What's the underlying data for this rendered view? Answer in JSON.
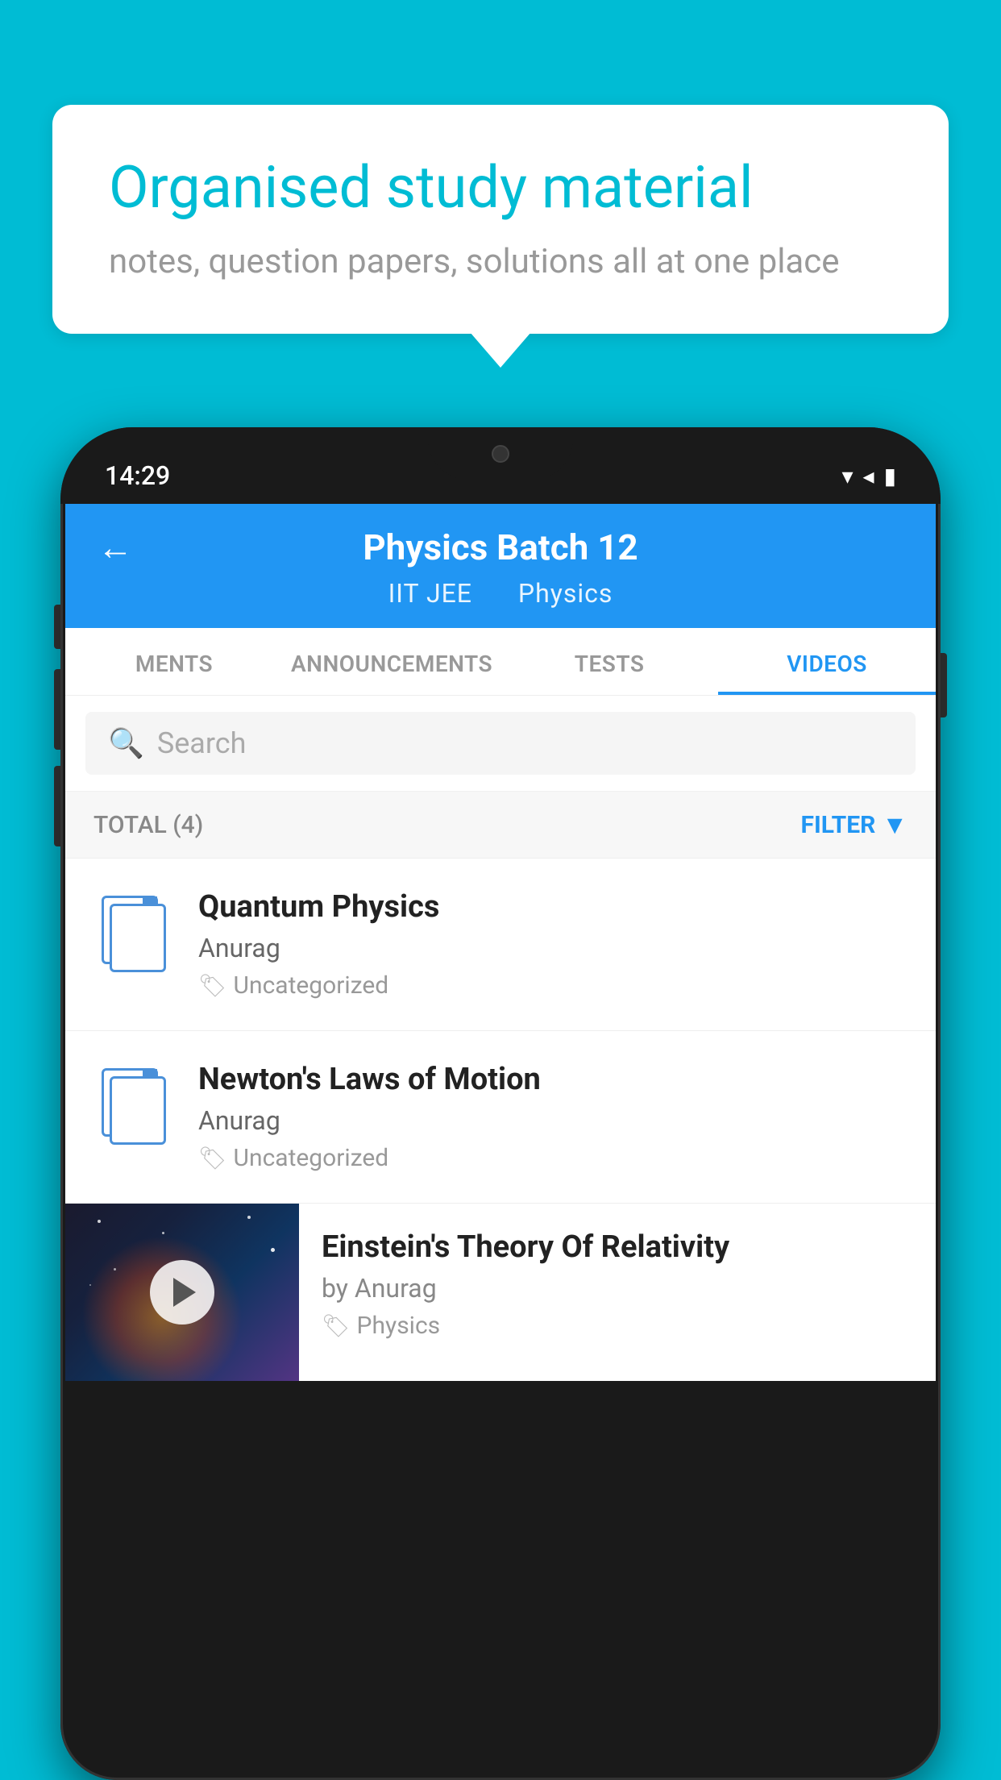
{
  "page": {
    "background_color": "#00bcd4"
  },
  "speech_bubble": {
    "title": "Organised study material",
    "subtitle": "notes, question papers, solutions all at one place"
  },
  "phone": {
    "status_bar": {
      "time": "14:29",
      "icons": [
        "wifi",
        "signal",
        "battery"
      ]
    },
    "header": {
      "back_label": "←",
      "title": "Physics Batch 12",
      "subtitle_left": "IIT JEE",
      "subtitle_right": "Physics"
    },
    "tabs": [
      {
        "label": "MENTS",
        "active": false
      },
      {
        "label": "ANNOUNCEMENTS",
        "active": false
      },
      {
        "label": "TESTS",
        "active": false
      },
      {
        "label": "VIDEOS",
        "active": true
      }
    ],
    "search": {
      "placeholder": "Search"
    },
    "filter_row": {
      "total_label": "TOTAL (4)",
      "filter_button": "FILTER"
    },
    "videos": [
      {
        "title": "Quantum Physics",
        "author": "Anurag",
        "tag": "Uncategorized",
        "has_thumb": false
      },
      {
        "title": "Newton's Laws of Motion",
        "author": "Anurag",
        "tag": "Uncategorized",
        "has_thumb": false
      },
      {
        "title": "Einstein's Theory Of Relativity",
        "author": "by Anurag",
        "tag": "Physics",
        "has_thumb": true
      }
    ]
  }
}
